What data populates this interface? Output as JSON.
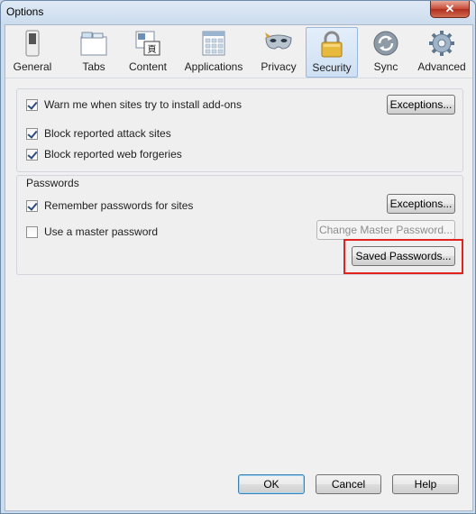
{
  "window": {
    "title": "Options",
    "close_glyph": "✕"
  },
  "toolbar": {
    "tabs": [
      {
        "label": "General",
        "icon": "switch-icon"
      },
      {
        "label": "Tabs",
        "icon": "tabs-icon"
      },
      {
        "label": "Content",
        "icon": "content-icon"
      },
      {
        "label": "Applications",
        "icon": "applications-icon"
      },
      {
        "label": "Privacy",
        "icon": "mask-icon"
      },
      {
        "label": "Security",
        "icon": "padlock-icon",
        "selected": true
      },
      {
        "label": "Sync",
        "icon": "sync-icon"
      },
      {
        "label": "Advanced",
        "icon": "gear-icon"
      }
    ]
  },
  "security_group": {
    "warn_addons": {
      "label": "Warn me when sites try to install add-ons",
      "checked": true
    },
    "block_attack": {
      "label": "Block reported attack sites",
      "checked": true
    },
    "block_forgeries": {
      "label": "Block reported web forgeries",
      "checked": true
    },
    "exceptions_label": "Exceptions..."
  },
  "passwords_group": {
    "title": "Passwords",
    "remember": {
      "label": "Remember passwords for sites",
      "checked": true
    },
    "master": {
      "label": "Use a master password",
      "checked": false
    },
    "exceptions_label": "Exceptions...",
    "change_master_label": "Change Master Password...",
    "saved_passwords_label": "Saved Passwords..."
  },
  "footer": {
    "ok_label": "OK",
    "cancel_label": "Cancel",
    "help_label": "Help"
  },
  "colors": {
    "highlight": "#e0231c",
    "selected_tab": "#cfe0f4"
  }
}
